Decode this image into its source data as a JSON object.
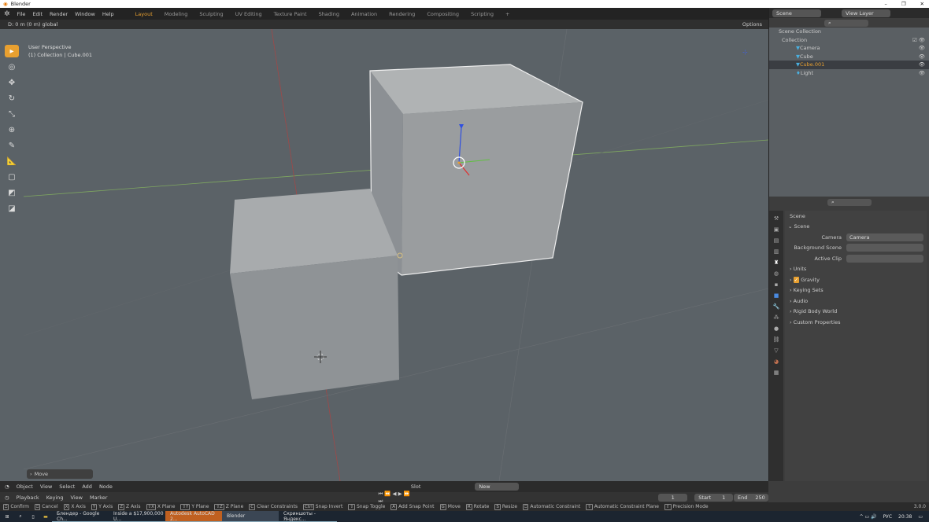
{
  "window": {
    "title": "Blender",
    "controls": [
      "–",
      "❐",
      "✕"
    ]
  },
  "menu": [
    "File",
    "Edit",
    "Render",
    "Window",
    "Help"
  ],
  "workspaces": [
    {
      "label": "Layout",
      "active": true
    },
    {
      "label": "Modeling"
    },
    {
      "label": "Sculpting"
    },
    {
      "label": "UV Editing"
    },
    {
      "label": "Texture Paint"
    },
    {
      "label": "Shading"
    },
    {
      "label": "Animation"
    },
    {
      "label": "Rendering"
    },
    {
      "label": "Compositing"
    },
    {
      "label": "Scripting"
    },
    {
      "label": "+"
    }
  ],
  "header": {
    "info": "D: 0 m (0 m) global",
    "options": "Options"
  },
  "viewport": {
    "view_name": "User Perspective",
    "context": "(1) Collection | Cube.001",
    "operator_panel": "Move"
  },
  "topright": {
    "scene": "Scene",
    "view_layer": "View Layer"
  },
  "outliner": {
    "root": "Scene Collection",
    "collection": "Collection",
    "items": [
      {
        "label": "Camera"
      },
      {
        "label": "Cube"
      },
      {
        "label": "Cube.001",
        "selected": true
      },
      {
        "label": "Light"
      }
    ]
  },
  "properties": {
    "context": "Scene",
    "panel": "Scene",
    "fields": [
      {
        "label": "Camera",
        "value": "Camera"
      },
      {
        "label": "Background Scene",
        "value": ""
      },
      {
        "label": "Active Clip",
        "value": ""
      }
    ],
    "sections": [
      "Units",
      "Gravity",
      "Keying Sets",
      "Audio",
      "Rigid Body World",
      "Custom Properties"
    ],
    "gravity_checked": true
  },
  "editor_header": {
    "mode": "Object",
    "items": [
      "View",
      "Select",
      "Add",
      "Node"
    ],
    "slot": "Slot",
    "new": "New"
  },
  "timeline": {
    "items": [
      "Playback",
      "Keying",
      "View",
      "Marker"
    ],
    "current_frame": "1",
    "start_label": "Start",
    "start": "1",
    "end_label": "End",
    "end": "250"
  },
  "status": [
    [
      "Confirm",
      ""
    ],
    [
      "Cancel",
      ""
    ],
    [
      "X Axis",
      "X"
    ],
    [
      "Y Axis",
      "Y"
    ],
    [
      "Z Axis",
      "Z"
    ],
    [
      "X Plane",
      "⇧X"
    ],
    [
      "Y Plane",
      "⇧Y"
    ],
    [
      "Z Plane",
      "⇧Z"
    ],
    [
      "Clear Constraints",
      "C"
    ],
    [
      "Snap Invert",
      "Ctrl"
    ],
    [
      "Snap Toggle",
      "⇧"
    ],
    [
      "Add Snap Point",
      "A"
    ],
    [
      "Move",
      "G"
    ],
    [
      "Rotate",
      "R"
    ],
    [
      "Resize",
      "S"
    ],
    [
      "Automatic Constraint",
      ""
    ],
    [
      "Automatic Constraint Plane",
      "⇧"
    ],
    [
      "Precision Mode",
      "⇧"
    ]
  ],
  "version": "3.0.0",
  "taskbar": {
    "tasks": [
      "Блендер - Google Ch...",
      "Inside a $17,900,000 U...",
      "Autodesk AutoCAD 2...",
      "Blender",
      "Скриншоты - Яндекс..."
    ],
    "lang": "РУС",
    "time": "20:38"
  }
}
